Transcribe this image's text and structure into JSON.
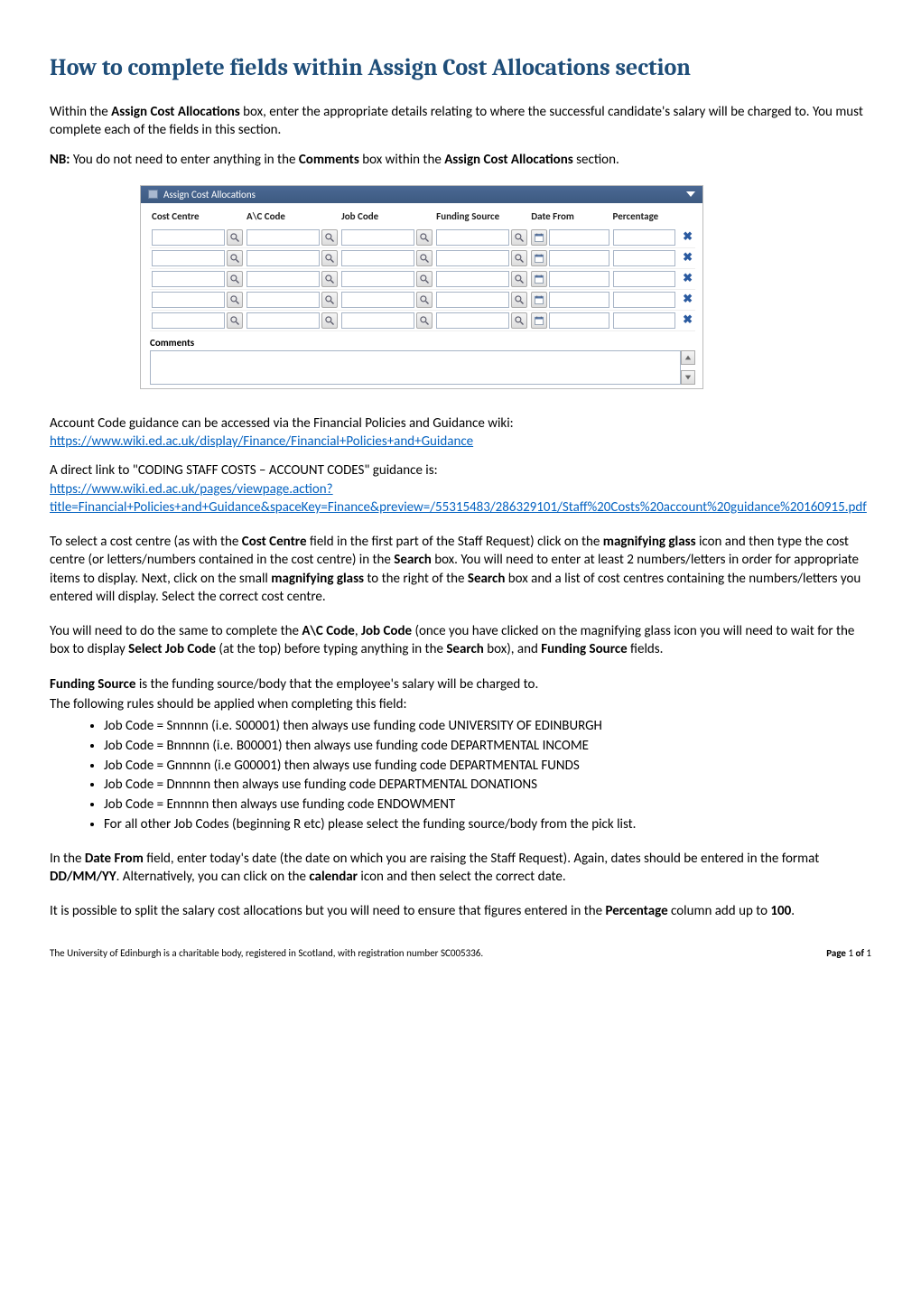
{
  "title": "How to complete fields within Assign Cost Allocations section",
  "intro1_a": "Within the ",
  "intro1_b": "Assign Cost Allocations",
  "intro1_c": " box, enter the appropriate details relating to where the successful candidate's salary will be charged to. You must complete each of the fields in this section.",
  "nb_a": "NB:",
  "nb_b": " You do not need to enter anything in the ",
  "nb_c": "Comments",
  "nb_d": " box within the ",
  "nb_e": "Assign Cost Allocations",
  "nb_f": " section.",
  "panel": {
    "title": "Assign Cost Allocations",
    "columns": {
      "cc": "Cost Centre",
      "ac": "A\\C Code",
      "jc": "Job Code",
      "fs": "Funding Source",
      "df": "Date From",
      "pct": "Percentage"
    },
    "comments_label": "Comments"
  },
  "p3_a": "Account Code guidance can be accessed via the Financial Policies and Guidance wiki:",
  "p3_link": "https://www.wiki.ed.ac.uk/display/Finance/Financial+Policies+and+Guidance",
  "p4_a": "A direct link to \"CODING STAFF COSTS – ACCOUNT CODES\" guidance is:",
  "p4_link": "https://www.wiki.ed.ac.uk/pages/viewpage.action?title=Financial+Policies+and+Guidance&spaceKey=Finance&preview=/55315483/286329101/Staff%20Costs%20account%20guidance%20160915.pdf",
  "p5_a": "To select a cost centre (as with the ",
  "p5_b": "Cost Centre",
  "p5_c": " field in the first part of the Staff Request) click on the ",
  "p5_d": "magnifying glass",
  "p5_e": " icon and then type the cost centre (or letters/numbers contained in the cost centre) in the ",
  "p5_f": "Search",
  "p5_g": " box. You will need to enter at least 2 numbers/letters in order for appropriate items to display. Next, click on the small ",
  "p5_h": "magnifying glass",
  "p5_i": " to the right of the ",
  "p5_j": "Search",
  "p5_k": " box and a list of cost centres containing the numbers/letters you entered will display. Select the correct cost centre.",
  "p6_a": "You will need to do the same to complete the ",
  "p6_b": "A\\C Code",
  "p6_c": ", ",
  "p6_d": "Job Code",
  "p6_e": " (once you have clicked on the magnifying glass icon you will need to wait for the box to display ",
  "p6_f": "Select Job Code",
  "p6_g": " (at the top) before typing anything in the ",
  "p6_h": "Search",
  "p6_i": " box), and ",
  "p6_j": "Funding Source",
  "p6_k": " fields.",
  "p7_a": "Funding Source",
  "p7_b": " is the funding source/body that the employee's salary will be charged to.",
  "p7_c": "The following rules should be applied when completing this field:",
  "bullets": [
    "Job Code = Snnnnn (i.e. S00001) then always use funding code UNIVERSITY OF EDINBURGH",
    "Job Code = Bnnnnn (i.e. B00001) then always use funding code DEPARTMENTAL INCOME",
    "Job Code = Gnnnnn (i.e G00001) then always use funding code DEPARTMENTAL FUNDS",
    "Job Code = Dnnnnn then always use funding code DEPARTMENTAL DONATIONS",
    "Job Code = Ennnnn then always use funding code ENDOWMENT",
    "For all other Job Codes (beginning  R etc) please select the funding source/body from the pick list."
  ],
  "p8_a": "In the ",
  "p8_b": "Date From",
  "p8_c": " field, enter today's date (the date on which you are raising the Staff Request). Again, dates should be entered in the format ",
  "p8_d": "DD/MM/YY",
  "p8_e": ". Alternatively, you can click on the ",
  "p8_f": "calendar",
  "p8_g": " icon and then select the correct date.",
  "p9_a": "It is possible to split the salary cost allocations but you will need to ensure that figures entered in the ",
  "p9_b": "Percentage",
  "p9_c": " column add up to ",
  "p9_d": "100",
  "p9_e": ".",
  "footer": {
    "left": "The University of Edinburgh is a charitable body, registered in Scotland, with registration number SC005336.",
    "page_a": "Page ",
    "page_b": "1",
    "page_c": " of ",
    "page_d": "1"
  },
  "glyphs": {
    "x": "✖"
  }
}
